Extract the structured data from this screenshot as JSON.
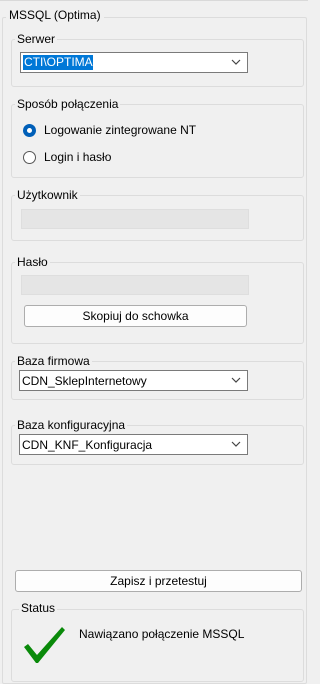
{
  "panel": {
    "title": "MSSQL (Optima)"
  },
  "server": {
    "legend": "Serwer",
    "value": "CTI\\OPTIMA"
  },
  "connection": {
    "legend": "Sposób połączenia",
    "options": [
      {
        "label": "Logowanie zintegrowane NT",
        "selected": true
      },
      {
        "label": "Login i hasło",
        "selected": false
      }
    ]
  },
  "user": {
    "legend": "Użytkownik",
    "value": ""
  },
  "password": {
    "legend": "Hasło",
    "value": "",
    "copy_button": "Skopiuj do schowka"
  },
  "company_db": {
    "legend": "Baza firmowa",
    "value": "CDN_SklepInternetowy"
  },
  "config_db": {
    "legend": "Baza konfiguracyjna",
    "value": "CDN_KNF_Konfiguracja"
  },
  "save_button": "Zapisz i przetestuj",
  "status": {
    "legend": "Status",
    "message": "Nawiązano połączenie MSSQL",
    "icon": "checkmark-icon",
    "icon_color": "#0a8a0a"
  },
  "colors": {
    "accent": "#0078d7",
    "radio_selected": "#005fb8"
  }
}
